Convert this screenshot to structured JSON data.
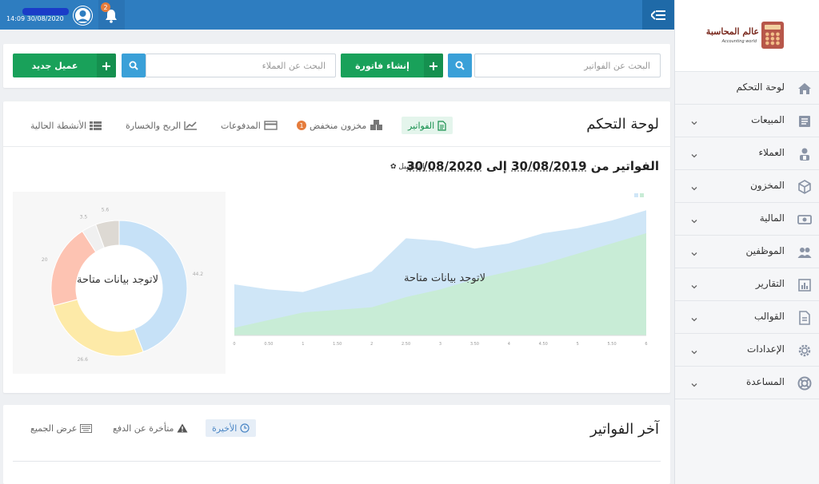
{
  "topbar": {
    "datetime": "14:09 30/08/2020",
    "notification_count": "2",
    "icons": {
      "menu": "menu-collapse-icon",
      "avatar": "user-avatar-icon",
      "bell": "bell-icon"
    }
  },
  "sidebar": {
    "logo": {
      "arabic": "عالم المحاسبة",
      "english": "Accounting world"
    },
    "items": [
      {
        "label": "لوحة التحكم",
        "icon": "home-icon",
        "expandable": false
      },
      {
        "label": "المبيعات",
        "icon": "sales-icon",
        "expandable": true
      },
      {
        "label": "العملاء",
        "icon": "clients-icon",
        "expandable": true
      },
      {
        "label": "المخزون",
        "icon": "box-icon",
        "expandable": true
      },
      {
        "label": "المالية",
        "icon": "money-icon",
        "expandable": true
      },
      {
        "label": "الموظفين",
        "icon": "employees-icon",
        "expandable": true
      },
      {
        "label": "التقارير",
        "icon": "reports-icon",
        "expandable": true
      },
      {
        "label": "القوالب",
        "icon": "template-icon",
        "expandable": true
      },
      {
        "label": "الإعدادات",
        "icon": "gear-icon",
        "expandable": true
      },
      {
        "label": "المساعدة",
        "icon": "help-icon",
        "expandable": true
      }
    ]
  },
  "search_bar": {
    "invoice_search_placeholder": "البحث عن الفواتير",
    "create_invoice_label": "إنشاء فاتورة",
    "client_search_placeholder": "البحث عن العملاء",
    "new_client_label": "عميل جديد"
  },
  "dashboard": {
    "title": "لوحة التحكم",
    "tabs": [
      {
        "label": "الفواتير",
        "icon": "invoice-icon",
        "active": true
      },
      {
        "label": "مخزون منخفض",
        "icon": "stock-icon",
        "badge": "1",
        "active": false
      },
      {
        "label": "المدفوعات",
        "icon": "credit-card-icon",
        "active": false
      },
      {
        "label": "الربح والخسارة",
        "icon": "chart-line-icon",
        "active": false
      },
      {
        "label": "الأنشطة الحالية",
        "icon": "list-icon",
        "active": false
      }
    ],
    "range": {
      "prefix": "الفواتير من",
      "from": "30/08/2019",
      "connector": "إلى",
      "to": "30/08/2020"
    },
    "details_label": "التفاصيل",
    "no_data_label": "لاتوجد بيانات متاحة"
  },
  "chart_data": [
    {
      "type": "area",
      "x": [
        0,
        0.5,
        1,
        1.5,
        2,
        2.5,
        3,
        3.5,
        4,
        4.5,
        5,
        5.5,
        6
      ],
      "x_tick_labels": [
        "0",
        "0.50",
        "1",
        "1.50",
        "2",
        "2.50",
        "3",
        "3.50",
        "4",
        "4.50",
        "5",
        "5.50",
        "6"
      ],
      "series": [
        {
          "values": [
            0.4,
            0.36,
            0.34,
            0.42,
            0.5,
            0.76,
            0.74,
            0.68,
            0.72,
            0.8,
            0.84,
            0.9,
            0.98
          ],
          "color": "#cfe6f7"
        },
        {
          "values": [
            0.06,
            0.12,
            0.18,
            0.2,
            0.22,
            0.3,
            0.36,
            0.44,
            0.5,
            0.56,
            0.64,
            0.72,
            0.8
          ],
          "color": "#c8ecd6"
        }
      ],
      "ylim": [
        0,
        1.05
      ]
    },
    {
      "type": "pie",
      "slices": [
        {
          "label": "44.2",
          "value": 44.2,
          "color": "#c6e1f7"
        },
        {
          "label": "26.6",
          "value": 26.6,
          "color": "#fdeaa8"
        },
        {
          "label": "20",
          "value": 20,
          "color": "#fdc3b2"
        },
        {
          "label": "3.5",
          "value": 3.5,
          "color": "#f0f0f0"
        },
        {
          "label": "5.6",
          "value": 5.6,
          "color": "#ddd9d3"
        }
      ]
    }
  ],
  "recent_invoices": {
    "title": "آخر الفواتير",
    "tabs": [
      {
        "label": "الأخيرة",
        "icon": "clock-icon",
        "active": true
      },
      {
        "label": "متأخرة عن الدفع",
        "icon": "warning-icon",
        "active": false
      },
      {
        "label": "عرض الجميع",
        "icon": "keyboard-icon",
        "active": false
      }
    ]
  }
}
